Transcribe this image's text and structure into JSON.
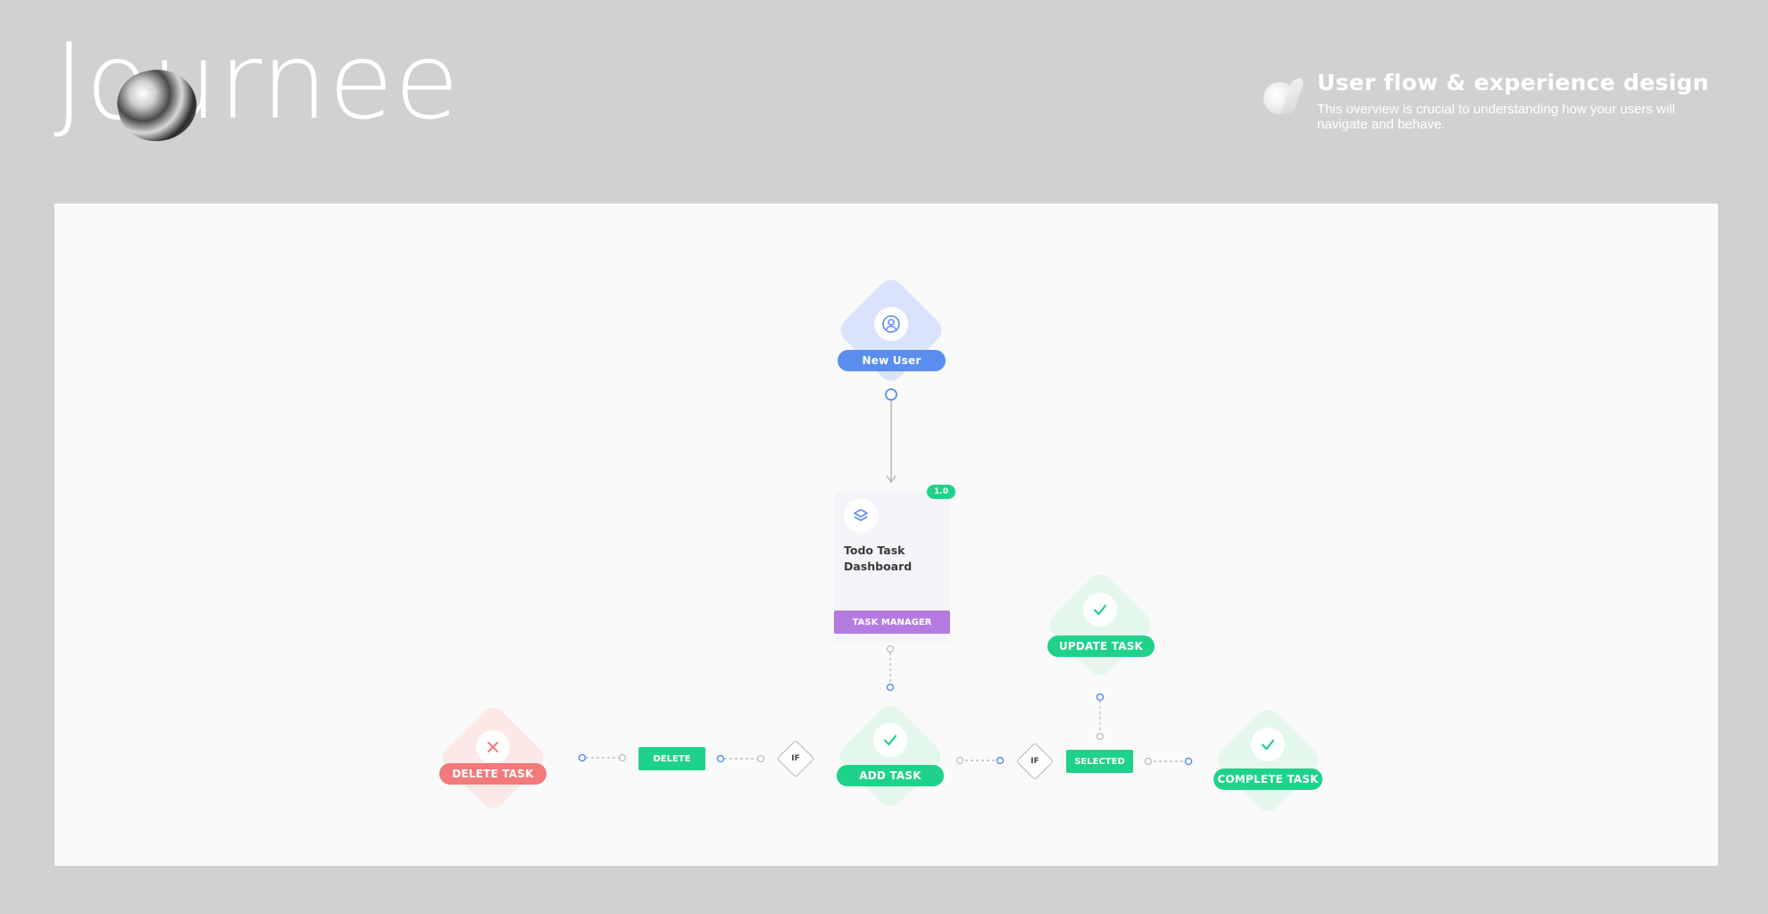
{
  "brand": {
    "logo_text": "Journee"
  },
  "header": {
    "title": "User flow & experience design",
    "subtitle": "This overview is crucial to understanding how your users will navigate and behave."
  },
  "colors": {
    "page_bg": "#d1d1d1",
    "canvas_bg": "#fafafa",
    "blue": "#5b8def",
    "green": "#1fd28a",
    "red": "#f37a7a",
    "purple": "#b57be0"
  },
  "flow": {
    "new_user": {
      "label": "New User",
      "icon": "user-circle-icon"
    },
    "dashboard": {
      "title": "Todo Task Dashboard",
      "badge": "1.0",
      "tag": "TASK MANAGER",
      "icon": "layers-icon"
    },
    "update_task": {
      "label": "UPDATE TASK",
      "icon": "check-icon"
    },
    "add_task": {
      "label": "ADD TASK",
      "icon": "check-icon"
    },
    "delete_task": {
      "label": "DELETE TASK",
      "icon": "close-icon"
    },
    "complete_task": {
      "label": "COMPLETE TASK",
      "icon": "check-icon"
    },
    "delete_condition": {
      "label": "DELETE"
    },
    "selected_condition": {
      "label": "SELECTED"
    },
    "if_left": {
      "label": "IF"
    },
    "if_right": {
      "label": "IF"
    }
  }
}
